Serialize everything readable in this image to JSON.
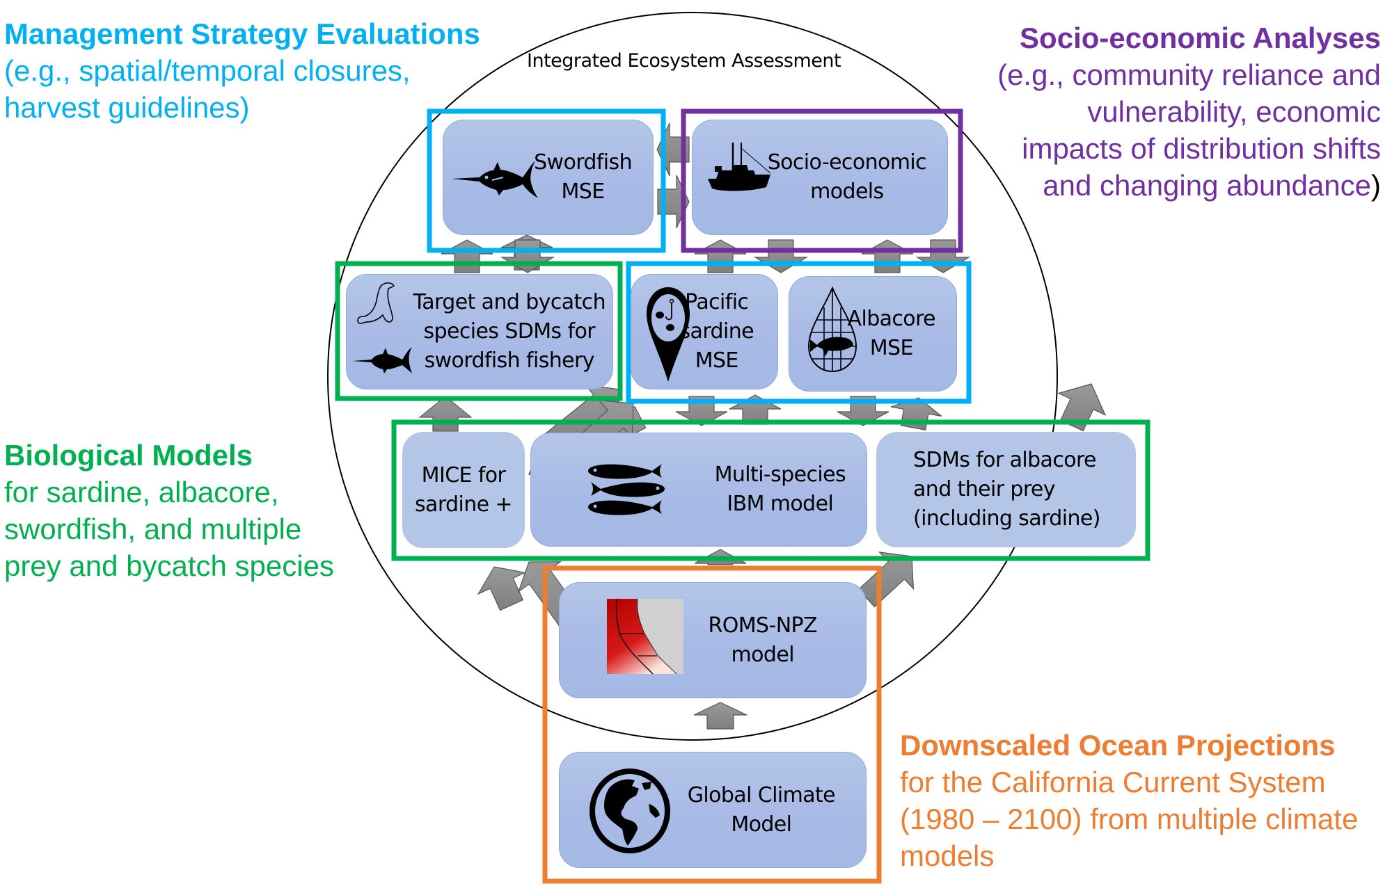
{
  "title": "Integrated Ecosystem Assessment",
  "colors": {
    "mse_blue": "#00b0f0",
    "socio_purple": "#7030a0",
    "bio_green": "#00b050",
    "ocean_orange": "#ed7d31",
    "node_fill": "#b4c6e7",
    "arrow_gray": "#8c8c8c"
  },
  "captions": {
    "mse": {
      "heading": "Management Strategy Evaluations",
      "lines": [
        "(e.g., spatial/temporal closures,",
        "harvest guidelines)"
      ]
    },
    "socio": {
      "heading": "Socio-economic Analyses",
      "lines": [
        "(e.g., community reliance and",
        "vulnerability, economic",
        "impacts of distribution shifts",
        "and changing abundance"
      ],
      "closing": ")"
    },
    "bio": {
      "heading": "Biological Models",
      "lines": [
        "for sardine, albacore,",
        "swordfish, and multiple",
        "prey and bycatch species"
      ]
    },
    "ocean": {
      "heading": "Downscaled Ocean Projections",
      "lines": [
        "for the California Current System",
        "(1980 – 2100) from multiple climate",
        "models"
      ]
    }
  },
  "nodes": {
    "swordfish_mse": {
      "label": "Swordfish\nMSE",
      "icon": "swordfish-icon"
    },
    "socio_models": {
      "label": "Socio-economic\nmodels",
      "icon": "fishing-boat-icon"
    },
    "target_bycatch": {
      "label": "Target and bycatch\nspecies SDMs for\nswordfish fishery",
      "icon": "sea-lion-and-swordfish-icon"
    },
    "pacific_sardine": {
      "label": "Pacific\nsardine\nMSE",
      "icon": "map-pin-fish-hook-icon"
    },
    "albacore_mse": {
      "label": "Albacore\nMSE",
      "icon": "fish-net-icon"
    },
    "mice": {
      "label": "MICE for\nsardine +"
    },
    "ibm": {
      "label": "Multi-species\nIBM model",
      "icon": "three-fish-icon"
    },
    "sdms_albacore": {
      "label": "SDMs for albacore\nand their prey\n(including sardine)"
    },
    "roms": {
      "label": "ROMS-NPZ\nmodel",
      "icon": "ocean-map-icon"
    },
    "gcm": {
      "label": "Global Climate\nModel",
      "icon": "globe-icon"
    }
  },
  "groups": [
    {
      "name": "mse-group-swordfish",
      "color": "mse_blue"
    },
    {
      "name": "socio-group",
      "color": "socio_purple"
    },
    {
      "name": "bio-group-upper",
      "color": "bio_green"
    },
    {
      "name": "mse-group-sardine-albacore",
      "color": "mse_blue"
    },
    {
      "name": "bio-group-lower",
      "color": "bio_green"
    },
    {
      "name": "ocean-group",
      "color": "ocean_orange"
    }
  ]
}
